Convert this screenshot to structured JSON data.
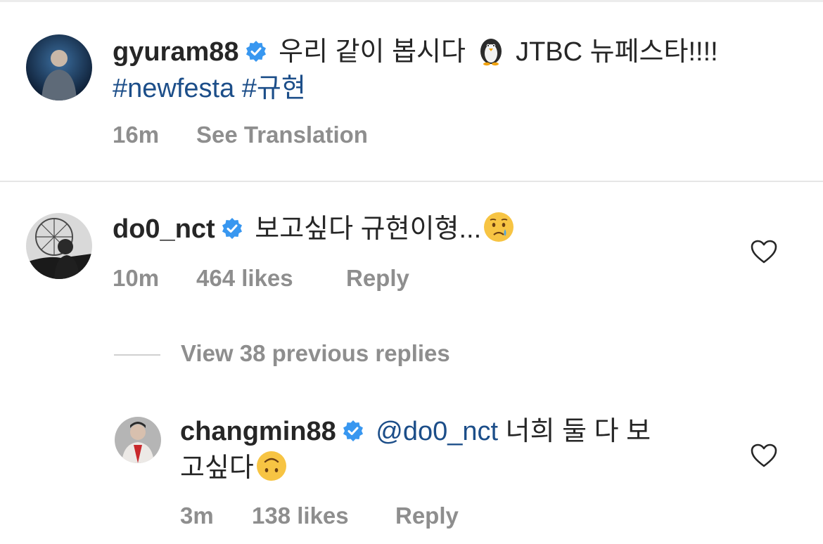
{
  "post": {
    "username": "gyuram88",
    "caption": "우리 같이 봅시다",
    "caption_after_emoji": "JTBC 뉴페스타!!!!",
    "hashtag1": "#newfesta",
    "hashtag2": "#규현",
    "time": "16m",
    "see_translation": "See Translation",
    "emoji_icon": "penguin-emoji"
  },
  "comment": {
    "username": "do0_nct",
    "text": "보고싶다 규현이형...",
    "time": "10m",
    "likes": "464 likes",
    "reply_label": "Reply",
    "emoji_icon": "crying-face-emoji"
  },
  "view_replies": "View 38 previous replies",
  "reply": {
    "username": "changmin88",
    "mention": "@do0_nct",
    "text_line1": "너희 둘 다 보",
    "text_line2": "고싶다",
    "time": "3m",
    "likes": "138 likes",
    "reply_label": "Reply",
    "emoji_icon": "upside-down-face-emoji"
  },
  "colors": {
    "verified_badge": "#3897f0",
    "link": "#1c4e89",
    "secondary_text": "#8e8e8e"
  }
}
